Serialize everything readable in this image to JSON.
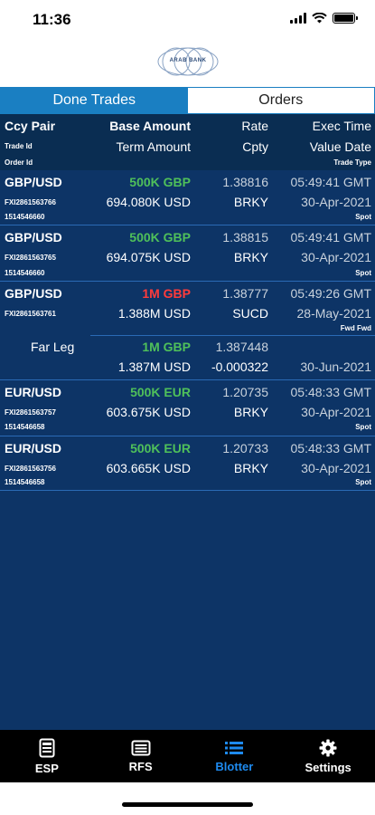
{
  "status": {
    "time": "11:36"
  },
  "logo": {
    "text": "ARAB BANK"
  },
  "tabs": [
    {
      "label": "Done Trades",
      "active": true
    },
    {
      "label": "Orders",
      "active": false
    }
  ],
  "header": {
    "col1": [
      "Ccy Pair",
      "Trade Id",
      "Order Id"
    ],
    "col2": [
      "Base Amount",
      "Term Amount"
    ],
    "col3": [
      "Rate",
      "Cpty"
    ],
    "col4": [
      "Exec Time",
      "Value Date",
      "Trade Type"
    ]
  },
  "trades": [
    {
      "pair": "GBP/USD",
      "trade_id": "FXI2861563766",
      "order_id": "1514546660",
      "base_amount": "500K GBP",
      "base_color": "green",
      "term_amount": "694.080K USD",
      "rate": "1.38816",
      "cpty": "BRKY",
      "exec_time": "05:49:41 GMT",
      "value_date": "30-Apr-2021",
      "trade_type": "Spot"
    },
    {
      "pair": "GBP/USD",
      "trade_id": "FXI2861563765",
      "order_id": "1514546660",
      "base_amount": "500K GBP",
      "base_color": "green",
      "term_amount": "694.075K USD",
      "rate": "1.38815",
      "cpty": "BRKY",
      "exec_time": "05:49:41 GMT",
      "value_date": "30-Apr-2021",
      "trade_type": "Spot"
    },
    {
      "pair": "GBP/USD",
      "trade_id": "FXI2861563761",
      "order_id": "",
      "base_amount": "1M GBP",
      "base_color": "red",
      "term_amount": "1.388M USD",
      "rate": "1.38777",
      "cpty": "SUCD",
      "exec_time": "05:49:26 GMT",
      "value_date": "28-May-2021",
      "trade_type": "Fwd Fwd",
      "far_leg": {
        "label": "Far Leg",
        "base_amount": "1M GBP",
        "term_amount": "1.387M USD",
        "rate": "1.387448",
        "points": "-0.000322",
        "value_date": "30-Jun-2021"
      }
    },
    {
      "pair": "EUR/USD",
      "trade_id": "FXI2861563757",
      "order_id": "1514546658",
      "base_amount": "500K EUR",
      "base_color": "green",
      "term_amount": "603.675K USD",
      "rate": "1.20735",
      "cpty": "BRKY",
      "exec_time": "05:48:33 GMT",
      "value_date": "30-Apr-2021",
      "trade_type": "Spot"
    },
    {
      "pair": "EUR/USD",
      "trade_id": "FXI2861563756",
      "order_id": "1514546658",
      "base_amount": "500K EUR",
      "base_color": "green",
      "term_amount": "603.665K USD",
      "rate": "1.20733",
      "cpty": "BRKY",
      "exec_time": "05:48:33 GMT",
      "value_date": "30-Apr-2021",
      "trade_type": "Spot"
    }
  ],
  "nav": [
    {
      "label": "ESP",
      "icon": "esp-icon",
      "active": false
    },
    {
      "label": "RFS",
      "icon": "rfs-icon",
      "active": false
    },
    {
      "label": "Blotter",
      "icon": "blotter-icon",
      "active": true
    },
    {
      "label": "Settings",
      "icon": "gear-icon",
      "active": false
    }
  ],
  "colors": {
    "accent": "#1a7fc2",
    "panel": "#0d3466",
    "header": "#0a2d52",
    "buy": "#4fc05a",
    "sell": "#ff3b3b",
    "nav_active": "#1e8bf0"
  }
}
